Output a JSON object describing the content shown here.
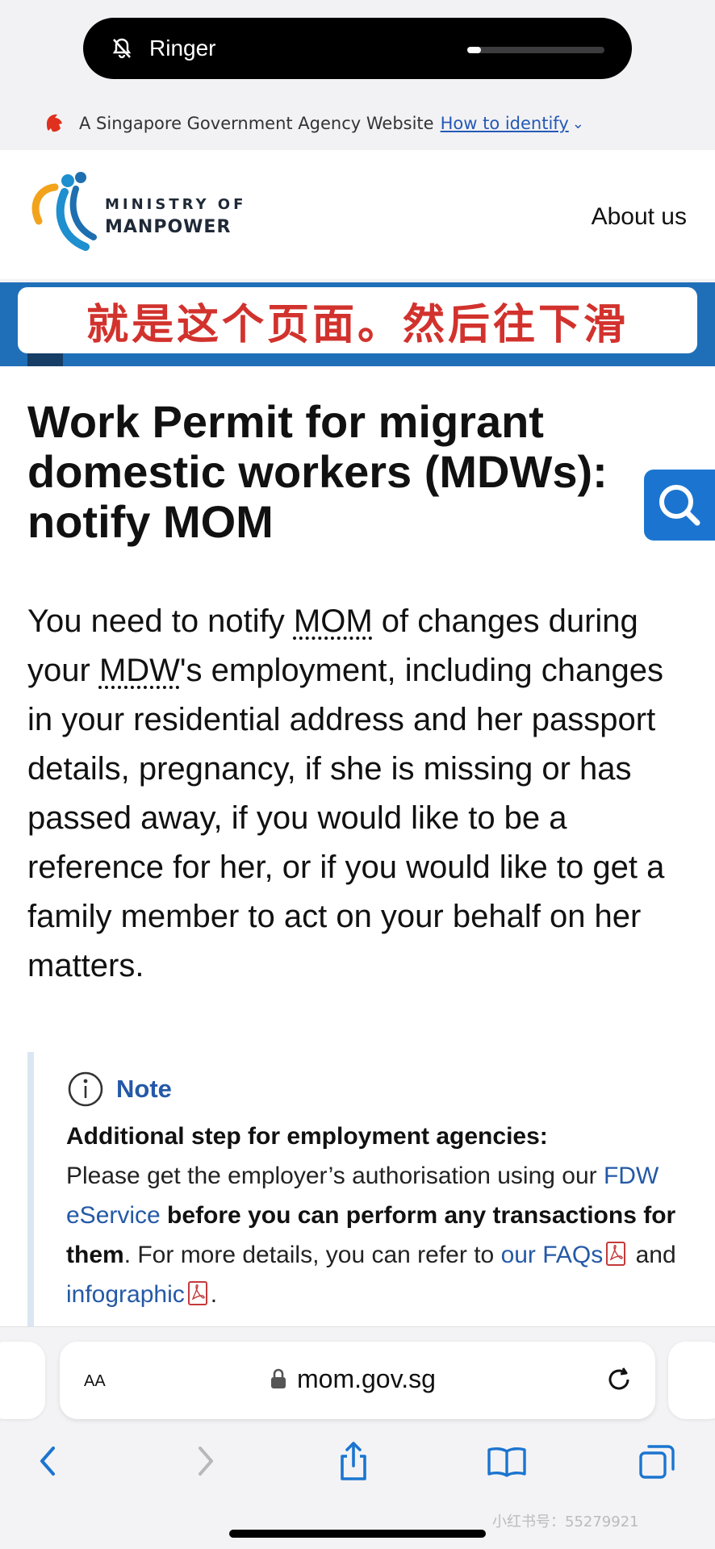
{
  "ringer": {
    "label": "Ringer",
    "volume": 0.1
  },
  "gov_banner": {
    "text": "A Singapore Government Agency Website",
    "link": "How to identify"
  },
  "header": {
    "logo_line1": "MINISTRY OF",
    "logo_line2": "MANPOWER",
    "nav_about": "About us"
  },
  "overlay_caption": "就是这个页面。然后往下滑",
  "page": {
    "title": "Work Permit for migrant domestic workers (MDWs): notify MOM",
    "lead_parts": {
      "p1": "You need to notify ",
      "mom": "MOM",
      "p2": " of changes during your ",
      "mdw": "MDW",
      "p3": "'s employment, including changes in your residential address and her passport details, pregnancy, if she is missing or has passed away, if you would like to be a reference for her, or if you would like to get a family member to act on your behalf on her matters."
    },
    "note": {
      "title": "Note",
      "heading": "Additional step for employment agencies:",
      "t1": "Please get the employer’s authorisation using our ",
      "link1": "FDW eService",
      "b1": " before you can perform any transactions for them",
      "t2": ". For more details, you can refer to ",
      "link2": "our FAQs",
      "t3": " and ",
      "link3": "infographic",
      "t4": "."
    }
  },
  "browser": {
    "aa_label": "AA",
    "url": "mom.gov.sg"
  },
  "watermark": "小红书号：55279921"
}
